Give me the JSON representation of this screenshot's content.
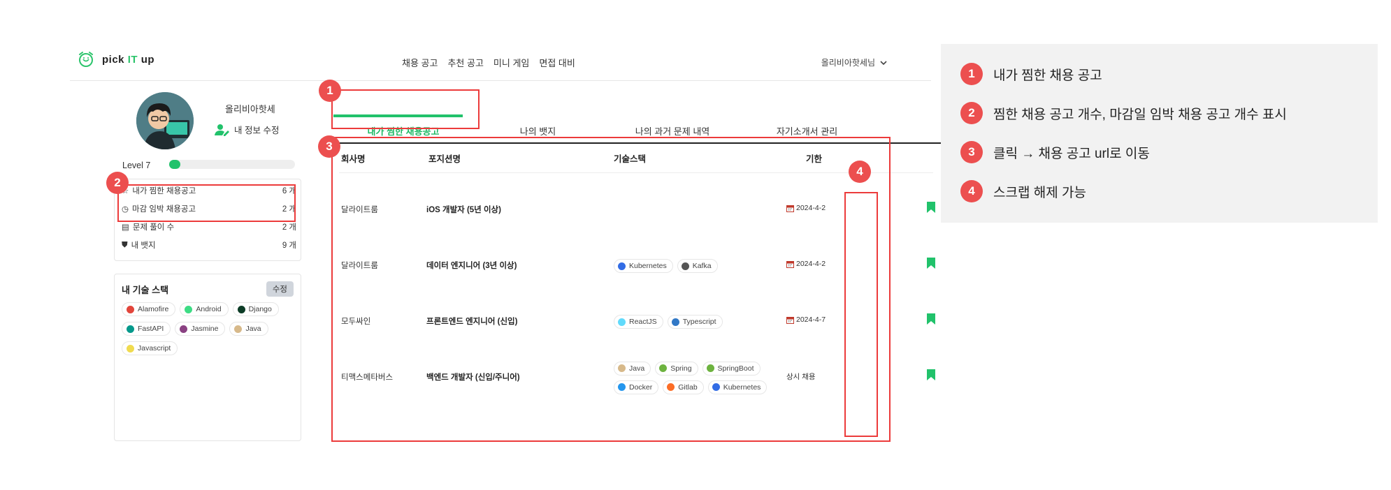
{
  "header": {
    "logo_text_pre": "pick ",
    "logo_text_accent": "IT",
    "logo_text_post": " up",
    "nav": [
      "채용 공고",
      "추천 공고",
      "미니 게임",
      "면접 대비"
    ],
    "user_name": "올리비아핫세님"
  },
  "profile": {
    "name": "올리비아핫세",
    "edit_label": "내 정보 수정",
    "level_label": "Level 7",
    "level_progress": 0.07
  },
  "stats": [
    {
      "label": "내가 찜한 채용공고",
      "value": "6 개",
      "icon": "star-icon"
    },
    {
      "label": "마감 임박 채용공고",
      "value": "2 개",
      "icon": "clock-icon"
    },
    {
      "label": "문제 풀이 수",
      "value": "2 개",
      "icon": "document-icon"
    },
    {
      "label": "내 뱃지",
      "value": "9 개",
      "icon": "shield-icon"
    }
  ],
  "skills": {
    "title": "내 기술 스택",
    "edit_label": "수정",
    "items": [
      {
        "name": "Alamofire",
        "color": "#e2453b"
      },
      {
        "name": "Android",
        "color": "#3ddc84"
      },
      {
        "name": "Django",
        "color": "#0c3c26"
      },
      {
        "name": "FastAPI",
        "color": "#05998b"
      },
      {
        "name": "Jasmine",
        "color": "#8a4182"
      },
      {
        "name": "Java",
        "color": "#d7b98a"
      },
      {
        "name": "Javascript",
        "color": "#f0db4f"
      }
    ]
  },
  "tabs": [
    "내가 찜한 채용공고",
    "나의 뱃지",
    "나의 과거 문제 내역",
    "자기소개서 관리"
  ],
  "table": {
    "headers": [
      "회사명",
      "포지션명",
      "기술스택",
      "기한"
    ],
    "rows": [
      {
        "company": "달라이트룸",
        "position": "iOS 개발자 (5년 이상)",
        "stack": [],
        "deadline": "2024-4-2",
        "has_calendar": true
      },
      {
        "company": "달라이트룸",
        "position": "데이터 엔지니어 (3년 이상)",
        "stack": [
          {
            "name": "Kubernetes",
            "color": "#326ce5"
          },
          {
            "name": "Kafka",
            "color": "#555555"
          }
        ],
        "deadline": "2024-4-2",
        "has_calendar": true
      },
      {
        "company": "모두싸인",
        "position": "프론트엔드 엔지니어 (신입)",
        "stack": [
          {
            "name": "ReactJS",
            "color": "#61dafb"
          },
          {
            "name": "Typescript",
            "color": "#3178c6"
          }
        ],
        "deadline": "2024-4-7",
        "has_calendar": true
      },
      {
        "company": "티맥스메타버스",
        "position": "백엔드 개발자 (신입/주니어)",
        "stack": [
          {
            "name": "Java",
            "color": "#d7b98a"
          },
          {
            "name": "Spring",
            "color": "#6db33f"
          },
          {
            "name": "SpringBoot",
            "color": "#6db33f"
          },
          {
            "name": "Docker",
            "color": "#2496ed"
          },
          {
            "name": "Gitlab",
            "color": "#fc6d26"
          },
          {
            "name": "Kubernetes",
            "color": "#326ce5"
          }
        ],
        "deadline": "상시 채용",
        "has_calendar": false
      }
    ]
  },
  "annotations": {
    "badges": [
      "1",
      "2",
      "3",
      "4"
    ],
    "legend": [
      {
        "num": "1",
        "text": "내가 찜한 채용 공고"
      },
      {
        "num": "2",
        "text": "찜한 채용 공고 개수, 마감일 임박 채용 공고 개수 표시"
      },
      {
        "num": "3",
        "text": "클릭 → 채용 공고 url로 이동"
      },
      {
        "num": "4",
        "text": "스크랩 해제 가능"
      }
    ]
  },
  "colors": {
    "accent_green": "#21c26b",
    "annotation_red": "#ec3b3b"
  }
}
